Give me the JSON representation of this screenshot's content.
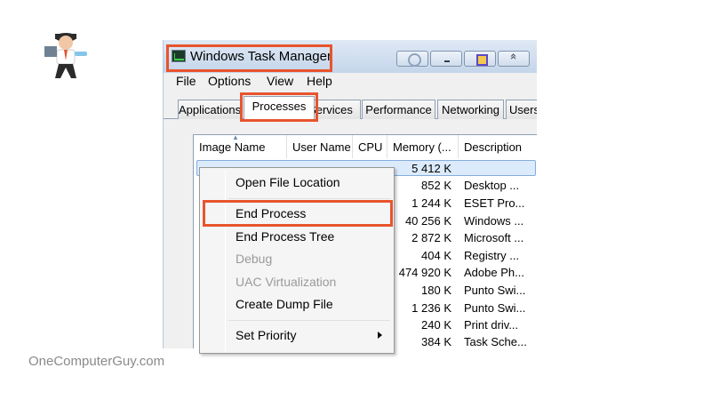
{
  "window": {
    "title": "Windows Task Manager"
  },
  "menubar": {
    "items": [
      "File",
      "Options",
      "View",
      "Help"
    ]
  },
  "tabs": [
    {
      "label": "Applications",
      "active": false
    },
    {
      "label": "Processes",
      "active": true
    },
    {
      "label": "Services",
      "active": false
    },
    {
      "label": "Performance",
      "active": false
    },
    {
      "label": "Networking",
      "active": false
    },
    {
      "label": "Users",
      "active": false
    }
  ],
  "columns": [
    "Image Name",
    "User Name",
    "CPU",
    "Memory (...",
    "Description"
  ],
  "rows": [
    {
      "memory": "5 412 K",
      "description": ""
    },
    {
      "memory": "852 K",
      "description": "Desktop ..."
    },
    {
      "memory": "1 244 K",
      "description": "ESET Pro..."
    },
    {
      "memory": "40 256 K",
      "description": "Windows ..."
    },
    {
      "memory": "2 872 K",
      "description": "Microsoft ..."
    },
    {
      "memory": "404 K",
      "description": "Registry ..."
    },
    {
      "memory": "474 920 K",
      "description": "Adobe Ph..."
    },
    {
      "memory": "180 K",
      "description": "Punto Swi..."
    },
    {
      "memory": "1 236 K",
      "description": "Punto Swi..."
    },
    {
      "memory": "240 K",
      "description": "Print driv..."
    },
    {
      "memory": "384 K",
      "description": "Task Sche..."
    }
  ],
  "context_menu": {
    "open_file_location": "Open File Location",
    "end_process": "End Process",
    "end_process_tree": "End Process Tree",
    "debug": "Debug",
    "uac_virtualization": "UAC Virtualization",
    "create_dump_file": "Create Dump File",
    "set_priority": "Set Priority"
  },
  "highlight_color": "#e8542d",
  "watermark": "OneComputerGuy.com"
}
